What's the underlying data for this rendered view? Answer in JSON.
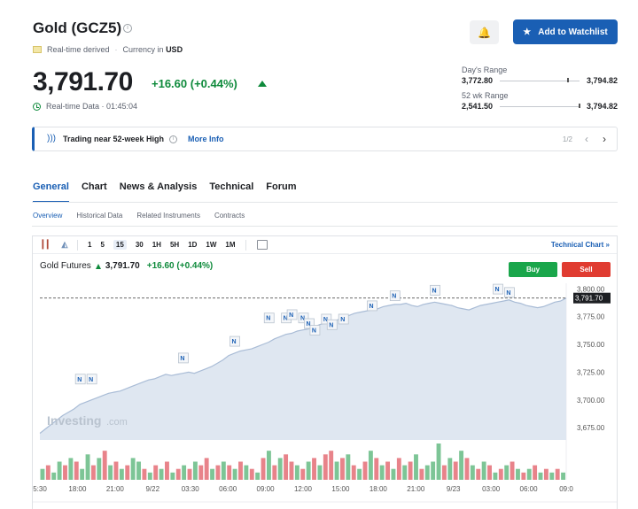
{
  "header": {
    "title": "Gold (GCZ5)",
    "info_glyph": "i",
    "realtime_label": "Real-time derived",
    "currency_label": "Currency in",
    "currency": "USD",
    "watchlist_button": "Add to Watchlist",
    "bell_glyph": "🔔"
  },
  "quote": {
    "price": "3,791.70",
    "change": "+16.60 (+0.44%)",
    "realtime_data": "Real-time Data · 01:45:04",
    "change_color": "#0e8a3b"
  },
  "ranges": {
    "day_label": "Day's Range",
    "day_low": "3,772.80",
    "day_high": "3,794.82",
    "day_position": 0.85,
    "week52_label": "52 wk Range",
    "week52_low": "2,541.50",
    "week52_high": "3,794.82",
    "week52_position": 0.99
  },
  "alert": {
    "text": "Trading near 52-week High",
    "info_glyph": "i",
    "more_info": "More Info",
    "pager": "1/2",
    "prev_glyph": "‹",
    "next_glyph": "›"
  },
  "tabs": [
    "General",
    "Chart",
    "News & Analysis",
    "Technical",
    "Forum"
  ],
  "subtabs": [
    "Overview",
    "Historical Data",
    "Related Instruments",
    "Contracts"
  ],
  "chart_toolbar": {
    "intervals": [
      "1",
      "5",
      "15",
      "30",
      "1H",
      "5H",
      "1D",
      "1W",
      "1M"
    ],
    "active_interval": "15",
    "technical_chart": "Technical Chart »",
    "candle_icon": "candlestick-icon",
    "area_icon": "area-chart-icon"
  },
  "chart_header": {
    "name": "Gold Futures",
    "price": "3,791.70",
    "change": "+16.60 (+0.44%)",
    "buy": "Buy",
    "sell": "Sell"
  },
  "watermark": {
    "brand": "Investing",
    "suffix": ".com"
  },
  "chart_data": {
    "type": "area",
    "x_ticks": [
      "5:30",
      "18:00",
      "21:00",
      "9/22",
      "03:30",
      "06:00",
      "09:00",
      "12:00",
      "15:00",
      "18:00",
      "21:00",
      "9/23",
      "03:00",
      "06:00",
      "09:0"
    ],
    "y_ticks": [
      3800,
      3775,
      3750,
      3725,
      3700,
      3675
    ],
    "y_tick_labels": [
      "3,800.00",
      "3,775.00",
      "3,750.00",
      "3,725.00",
      "3,700.00",
      "3,675.00"
    ],
    "ylim": [
      3664,
      3805
    ],
    "current_value": 3791.7,
    "current_label": "3,791.70",
    "values": [
      3670,
      3674,
      3678,
      3682,
      3686,
      3689,
      3692,
      3696,
      3698,
      3700,
      3702,
      3704,
      3706,
      3707,
      3708,
      3710,
      3712,
      3714,
      3716,
      3718,
      3719,
      3721,
      3723,
      3722,
      3723,
      3724,
      3725,
      3724,
      3726,
      3728,
      3730,
      3733,
      3736,
      3740,
      3742,
      3744,
      3745,
      3746,
      3748,
      3750,
      3752,
      3755,
      3757,
      3759,
      3760,
      3762,
      3763,
      3764,
      3766,
      3768,
      3769,
      3770,
      3772,
      3774,
      3776,
      3778,
      3779,
      3780,
      3781,
      3782,
      3784,
      3785,
      3786,
      3786,
      3787,
      3785,
      3784,
      3786,
      3787,
      3788,
      3787,
      3786,
      3785,
      3783,
      3782,
      3781,
      3783,
      3785,
      3786,
      3787,
      3788,
      3789,
      3790,
      3788,
      3787,
      3785,
      3784,
      3783,
      3784,
      3786,
      3788,
      3789,
      3791.7
    ],
    "news_markers": [
      {
        "i": 7,
        "v": 3708
      },
      {
        "i": 9,
        "v": 3708
      },
      {
        "i": 25,
        "v": 3727
      },
      {
        "i": 34,
        "v": 3742
      },
      {
        "i": 40,
        "v": 3763
      },
      {
        "i": 43,
        "v": 3763
      },
      {
        "i": 44,
        "v": 3766
      },
      {
        "i": 46,
        "v": 3763
      },
      {
        "i": 47,
        "v": 3758
      },
      {
        "i": 48,
        "v": 3752
      },
      {
        "i": 50,
        "v": 3762
      },
      {
        "i": 51,
        "v": 3757
      },
      {
        "i": 53,
        "v": 3762
      },
      {
        "i": 58,
        "v": 3774
      },
      {
        "i": 62,
        "v": 3783
      },
      {
        "i": 69,
        "v": 3788
      },
      {
        "i": 80,
        "v": 3789
      },
      {
        "i": 82,
        "v": 3786
      }
    ],
    "volume": [
      3,
      4,
      2,
      5,
      4,
      6,
      5,
      3,
      7,
      4,
      6,
      8,
      4,
      5,
      3,
      4,
      6,
      5,
      3,
      2,
      4,
      3,
      5,
      2,
      3,
      4,
      3,
      5,
      4,
      6,
      3,
      4,
      5,
      4,
      3,
      5,
      4,
      3,
      2,
      6,
      8,
      4,
      6,
      7,
      5,
      4,
      3,
      5,
      6,
      4,
      7,
      8,
      5,
      6,
      7,
      4,
      3,
      5,
      8,
      6,
      4,
      5,
      3,
      6,
      4,
      5,
      7,
      3,
      4,
      5,
      10,
      4,
      6,
      5,
      8,
      6,
      4,
      3,
      5,
      4,
      2,
      3,
      4,
      5,
      3,
      2,
      3,
      4,
      2,
      3,
      2,
      3,
      2
    ],
    "volume_colors": [
      "g",
      "r",
      "g",
      "g",
      "r",
      "g",
      "r",
      "g",
      "g",
      "r",
      "g",
      "r",
      "g",
      "r",
      "g",
      "r",
      "g",
      "g",
      "r",
      "g",
      "r",
      "g",
      "r",
      "g",
      "r",
      "g",
      "r",
      "g",
      "r",
      "r",
      "g",
      "r",
      "g",
      "r",
      "g",
      "r",
      "g",
      "r",
      "g",
      "r",
      "g",
      "r",
      "g",
      "r",
      "r",
      "g",
      "r",
      "g",
      "r",
      "g",
      "r",
      "r",
      "g",
      "r",
      "g",
      "r",
      "g",
      "r",
      "g",
      "r",
      "g",
      "r",
      "g",
      "r",
      "g",
      "r",
      "g",
      "r",
      "g",
      "g",
      "g",
      "r",
      "g",
      "r",
      "g",
      "r",
      "g",
      "r",
      "g",
      "r",
      "g",
      "r",
      "g",
      "r",
      "g",
      "r",
      "g",
      "r",
      "g",
      "r",
      "g",
      "r",
      "g"
    ]
  },
  "colors": {
    "accent": "#1a5fb4",
    "up": "#0e8a3b",
    "buy": "#1aa64b",
    "sell": "#e03c31",
    "area_fill": "#dfe7f1",
    "area_line": "#a9bcd6",
    "vol_up": "#7dc596",
    "vol_down": "#e8838a"
  }
}
